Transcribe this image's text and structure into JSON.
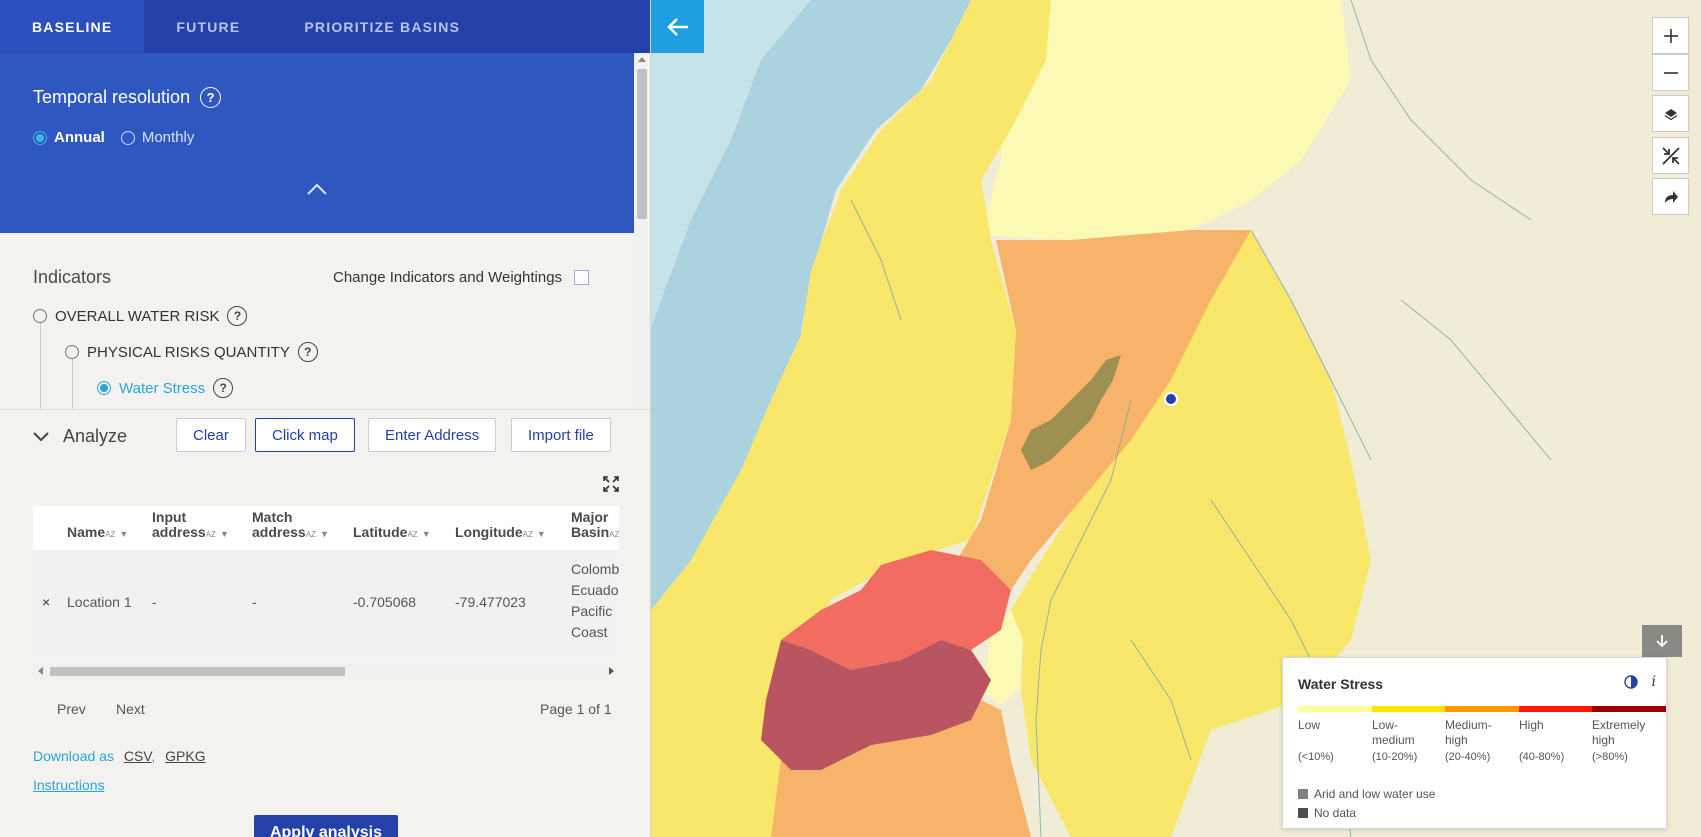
{
  "tabs": [
    {
      "label": "BASELINE",
      "active": true
    },
    {
      "label": "FUTURE",
      "active": false
    },
    {
      "label": "PRIORITIZE BASINS",
      "active": false
    }
  ],
  "temporal": {
    "title": "Temporal resolution",
    "help": "?",
    "options": [
      {
        "label": "Annual",
        "selected": true
      },
      {
        "label": "Monthly",
        "selected": false
      }
    ]
  },
  "indicators": {
    "title": "Indicators",
    "change_label": "Change Indicators and Weightings",
    "change_checked": false,
    "items": [
      {
        "label": "OVERALL WATER RISK",
        "selected": false
      },
      {
        "label": "PHYSICAL RISKS QUANTITY",
        "selected": false
      },
      {
        "label": "Water Stress",
        "selected": true
      }
    ]
  },
  "analyze": {
    "title": "Analyze",
    "buttons": {
      "clear": "Clear",
      "click_map": "Click map",
      "enter_address": "Enter Address",
      "import_file": "Import file"
    },
    "table": {
      "columns": [
        {
          "l1": "",
          "l2": "Name"
        },
        {
          "l1": "Input",
          "l2": "address"
        },
        {
          "l1": "Match",
          "l2": "address"
        },
        {
          "l1": "",
          "l2": "Latitude"
        },
        {
          "l1": "",
          "l2": "Longitude"
        },
        {
          "l1": "Major",
          "l2": "Basin"
        }
      ],
      "rows": [
        {
          "remove": "×",
          "name": "Location 1",
          "input_address": "-",
          "match_address": "-",
          "latitude": "-0.705068",
          "longitude": "-79.477023",
          "basin": [
            "Colomb",
            "Ecuador",
            "Pacific",
            "Coast"
          ]
        }
      ]
    },
    "pager": {
      "prev": "Prev",
      "next": "Next",
      "page": "Page 1 of 1"
    },
    "download_prefix": "Download as",
    "download_csv": "CSV",
    "download_gpkg": "GPKG",
    "instructions": "Instructions",
    "apply": "Apply analysis"
  },
  "legend": {
    "title": "Water Stress",
    "info": "i",
    "categories": [
      {
        "label": "Low",
        "range": "(<10%)",
        "color": "#ffff99"
      },
      {
        "label": "Low-medium",
        "range": "(10-20%)",
        "color": "#ffe600"
      },
      {
        "label": "Medium-high",
        "range": "(20-40%)",
        "color": "#ff9900"
      },
      {
        "label": "High",
        "range": "(40-80%)",
        "color": "#ff1900"
      },
      {
        "label": "Extremely high",
        "range": "(>80%)",
        "color": "#990000"
      }
    ],
    "arid": {
      "label": "Arid and low water use",
      "color": "#808080"
    },
    "nodata": {
      "label": "No data",
      "color": "#4e4e4e"
    }
  },
  "colors": {
    "tab_bar": "#2341a8",
    "panel_blue": "#2f57c0",
    "accent": "#1f9ee0"
  }
}
